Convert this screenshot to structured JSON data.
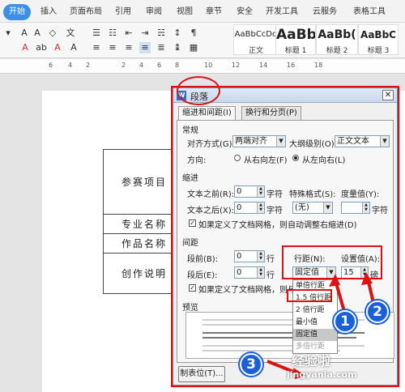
{
  "ribbon": {
    "tabs": [
      "开始",
      "插入",
      "页面布局",
      "引用",
      "审阅",
      "视图",
      "章节",
      "安全",
      "开发工具",
      "云服务",
      "表格工具"
    ],
    "styles": [
      {
        "sample": "AaBbCcDd",
        "label": "正文"
      },
      {
        "sample": "AaBb",
        "label": "标题 1"
      },
      {
        "sample": "AaBb(",
        "label": "标题 2"
      },
      {
        "sample": "AaBbC",
        "label": "标题 3"
      }
    ]
  },
  "ruler": {
    "marks": [
      "6",
      "4",
      "2",
      "2",
      "4",
      "6",
      "8",
      "10",
      "12",
      "14",
      "16",
      "18"
    ]
  },
  "document": {
    "rows": [
      "参赛项目",
      "专业名称",
      "作品名称",
      "创作说明"
    ]
  },
  "dialog": {
    "title": "段落",
    "tabs": [
      "缩进和间距(I)",
      "换行和分页(P)"
    ],
    "general": {
      "heading": "常规",
      "align_label": "对齐方式(G):",
      "align_value": "两端对齐",
      "outline_label": "大纲级别(O):",
      "outline_value": "正文文本",
      "direction_label": "方向:",
      "rtl_label": "从右向左(F)",
      "ltr_label": "从左向右(L)"
    },
    "indent": {
      "heading": "缩进",
      "before_label": "文本之前(R):",
      "before_value": "0",
      "after_label": "文本之后(X):",
      "after_value": "0",
      "unit": "字符",
      "special_label": "特殊格式(S):",
      "special_value": "(无)",
      "measure_label": "度量值(Y):",
      "measure_unit": "字符",
      "grid_check": "如果定义了文档网格，则自动调整右缩进(D)"
    },
    "spacing": {
      "heading": "间距",
      "before_label": "段前(B):",
      "before_value": "0",
      "after_label": "段后(E):",
      "after_value": "0",
      "unit": "行",
      "line_label": "行距(N):",
      "line_value": "固定值",
      "set_label": "设置值(A):",
      "set_value": "15",
      "set_unit": "磅",
      "grid_check": "如果定义了文档网格，则与"
    },
    "line_options": [
      "单倍行距",
      "1.5 倍行距",
      "2 倍行距",
      "最小值",
      "固定值",
      "多倍行距"
    ],
    "line_selected": "固定值",
    "preview_heading": "预览",
    "tab_button": "制表位(T)..."
  },
  "annotations": {
    "steps": [
      "1",
      "2",
      "3"
    ]
  },
  "watermark": {
    "line1": "经验啦",
    "line2": "jingyanla.com"
  },
  "colors": {
    "accent": "#3d8ee6",
    "annotation": "#dd1111",
    "step_badge": "#1a5fd6"
  }
}
